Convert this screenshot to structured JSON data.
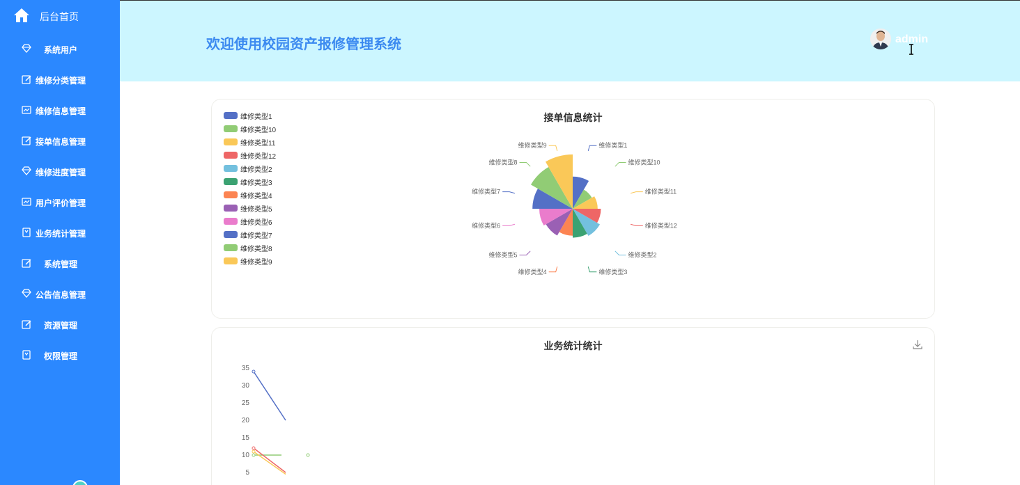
{
  "sidebar": {
    "home_label": "后台首页",
    "items": [
      {
        "label": "系统用户",
        "icon": "diamond-icon"
      },
      {
        "label": "维修分类管理",
        "icon": "edit-icon"
      },
      {
        "label": "维修信息管理",
        "icon": "chart-line-icon"
      },
      {
        "label": "接单信息管理",
        "icon": "edit-icon"
      },
      {
        "label": "维修进度管理",
        "icon": "diamond-icon"
      },
      {
        "label": "用户评价管理",
        "icon": "chart-line-icon"
      },
      {
        "label": "业务统计管理",
        "icon": "bookmark-icon"
      },
      {
        "label": "系统管理",
        "icon": "edit-icon"
      },
      {
        "label": "公告信息管理",
        "icon": "diamond-icon"
      },
      {
        "label": "资源管理",
        "icon": "edit-icon"
      },
      {
        "label": "权限管理",
        "icon": "bookmark-icon"
      }
    ]
  },
  "header": {
    "title": "欢迎使用校园资产报修管理系统",
    "username": "admin"
  },
  "colors": {
    "sidebar_bg": "#2b88ff",
    "header_bg": "#ccf6ff",
    "title_color": "#3c8af0",
    "palette": [
      "#5470c6",
      "#91cc75",
      "#fac858",
      "#ee6666",
      "#73c0de",
      "#3ba272",
      "#fc8452",
      "#9a60b4",
      "#ea7ccc"
    ]
  },
  "chart_data": [
    {
      "type": "pie",
      "title": "接单信息统计",
      "legend_position": "top-left",
      "labels": [
        "维修类型1",
        "维修类型10",
        "维修类型11",
        "维修类型12",
        "维修类型2",
        "维修类型3",
        "维修类型4",
        "维修类型5",
        "维修类型6",
        "维修类型7",
        "维修类型8",
        "维修类型9"
      ],
      "values": [
        80,
        55,
        62,
        70,
        78,
        72,
        67,
        77,
        83,
        100,
        120,
        135
      ],
      "rose_type": "radius"
    },
    {
      "type": "line",
      "title": "业务统计统计",
      "ylim": [
        0,
        35
      ],
      "yticks": [
        5,
        10,
        15,
        20,
        25,
        30,
        35
      ],
      "series": [
        {
          "values": [
            34,
            20
          ],
          "color": "#5470c6"
        },
        {
          "values": [
            10,
            10,
            10
          ],
          "color": "#91cc75"
        },
        {
          "values": [
            11,
            4.5
          ],
          "color": "#fac858"
        },
        {
          "values": [
            12,
            5
          ],
          "color": "#ee6666"
        }
      ]
    }
  ]
}
